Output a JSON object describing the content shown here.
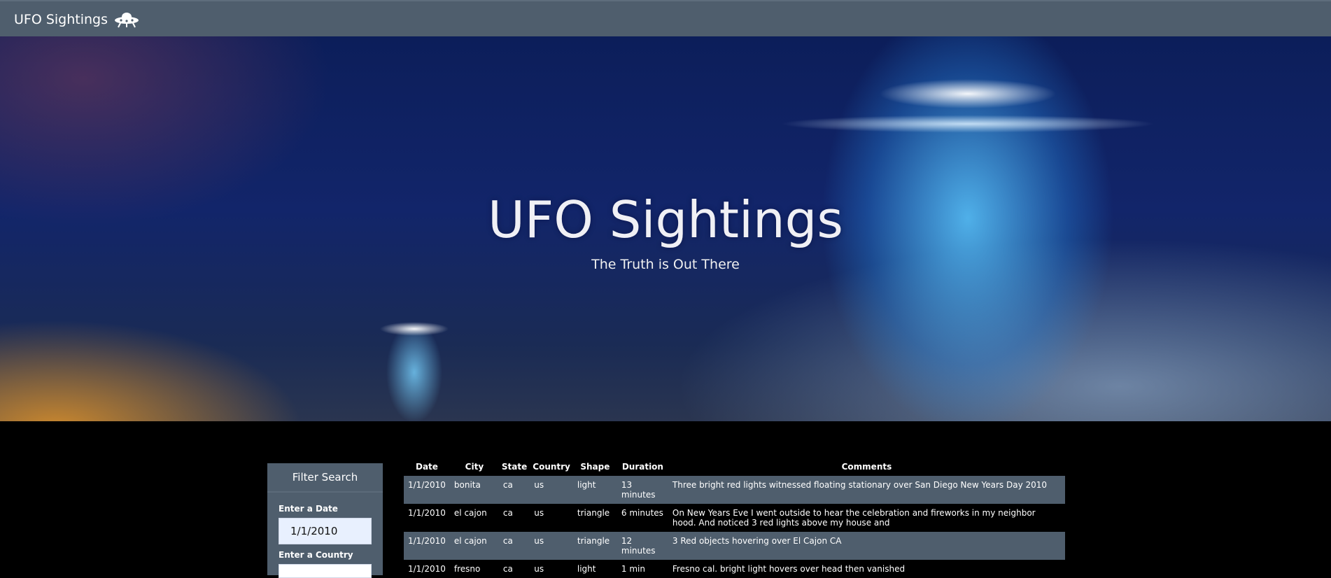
{
  "navbar": {
    "brand": "UFO Sightings",
    "brand_icon": "ufo-icon"
  },
  "hero": {
    "title": "UFO Sightings",
    "subtitle": "The Truth is Out There"
  },
  "filter": {
    "heading": "Filter Search",
    "date_label": "Enter a Date",
    "date_value": "1/1/2010",
    "country_label": "Enter a Country"
  },
  "table": {
    "headers": [
      "Date",
      "City",
      "State",
      "Country",
      "Shape",
      "Duration",
      "Comments"
    ],
    "rows": [
      [
        "1/1/2010",
        "bonita",
        "ca",
        "us",
        "light",
        "13 minutes",
        "Three bright red lights witnessed floating stationary over San Diego New Years Day 2010"
      ],
      [
        "1/1/2010",
        "el cajon",
        "ca",
        "us",
        "triangle",
        "6 minutes",
        "On New Years Eve I went outside to hear the celebration and fireworks in my neighbor hood. And noticed 3 red lights above my house and"
      ],
      [
        "1/1/2010",
        "el cajon",
        "ca",
        "us",
        "triangle",
        "12 minutes",
        "3 Red objects hovering over El Cajon CA"
      ],
      [
        "1/1/2010",
        "fresno",
        "ca",
        "us",
        "light",
        "1 min",
        "Fresno cal. bright light hovers over head then vanished"
      ]
    ]
  }
}
